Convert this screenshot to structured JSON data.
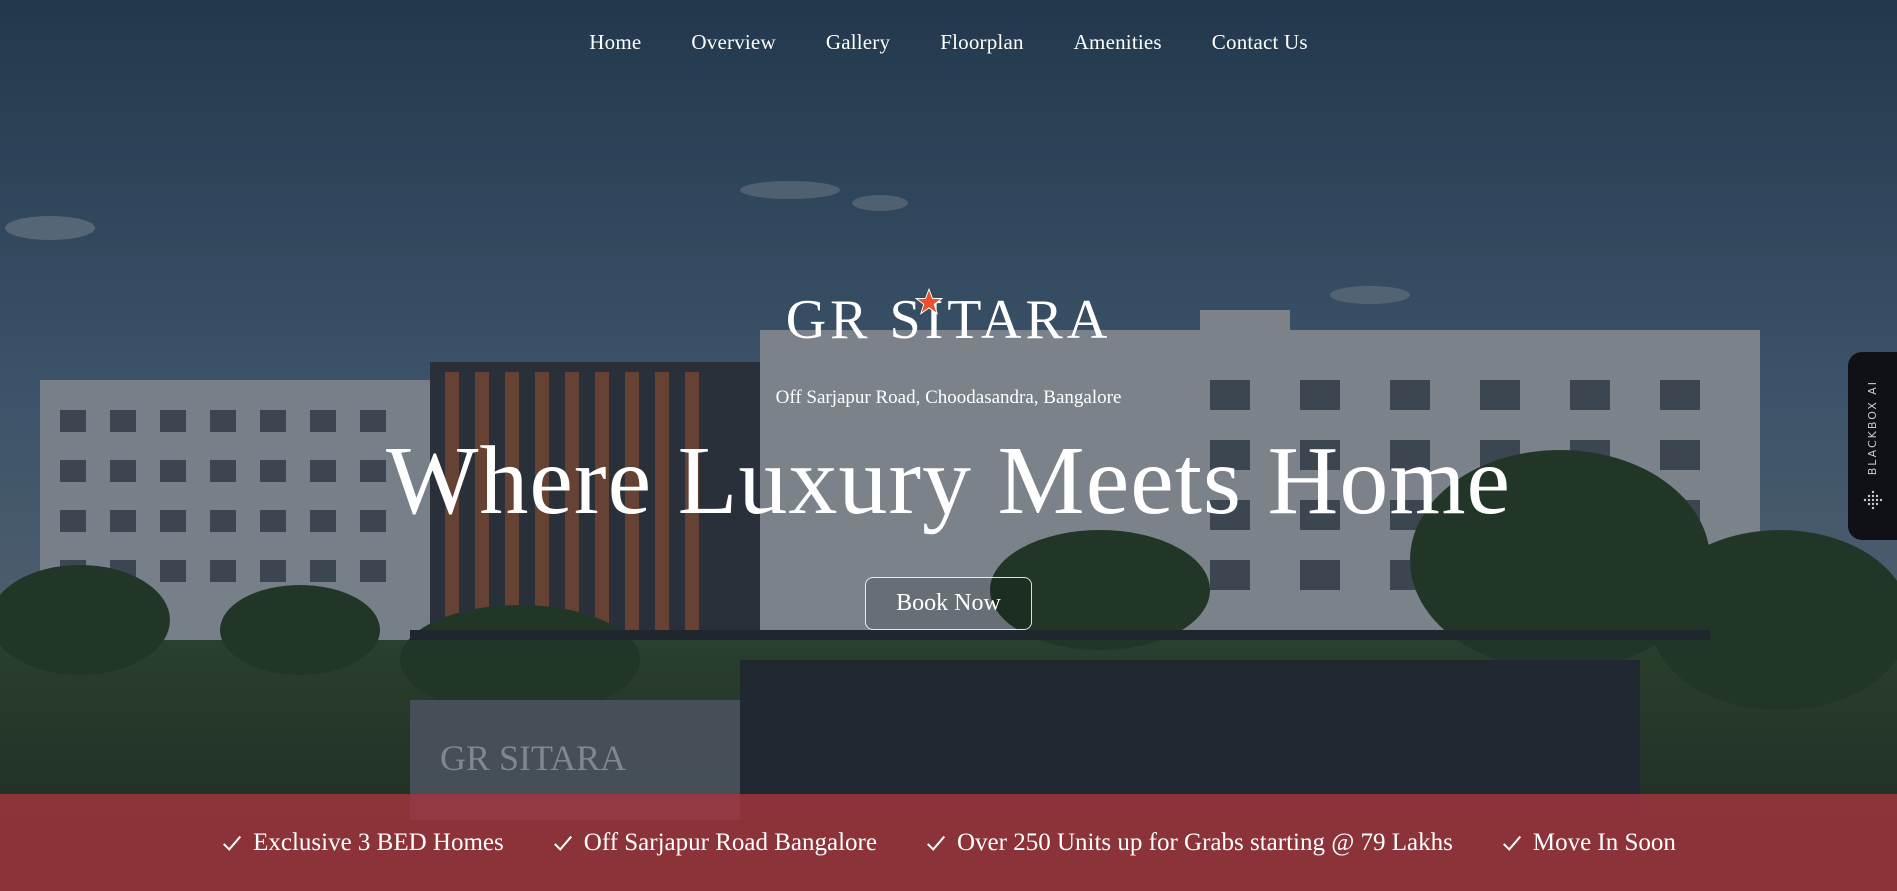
{
  "nav": {
    "items": [
      {
        "label": "Home"
      },
      {
        "label": "Overview"
      },
      {
        "label": "Gallery"
      },
      {
        "label": "Floorplan"
      },
      {
        "label": "Amenities"
      },
      {
        "label": "Contact Us"
      }
    ]
  },
  "hero": {
    "logo_text": "GR SITARA",
    "address": "Off Sarjapur Road, Choodasandra, Bangalore",
    "headline": "Where Luxury Meets Home",
    "cta_label": "Book Now",
    "signage_text": "GR SITARA"
  },
  "features": [
    {
      "label": "Exclusive 3 BED Homes",
      "icon": "check-icon"
    },
    {
      "label": "Off Sarjapur Road Bangalore",
      "icon": "check-icon"
    },
    {
      "label": "Over 250 Units up for Grabs starting @ 79 Lakhs",
      "icon": "check-icon"
    },
    {
      "label": "Move In Soon",
      "icon": "check-icon"
    }
  ],
  "side_widget": {
    "label": "BLACKBOX AI"
  },
  "colors": {
    "accent_bar": "#a5343e",
    "star": "#e8512b",
    "overlay": "#1e2a3a"
  }
}
